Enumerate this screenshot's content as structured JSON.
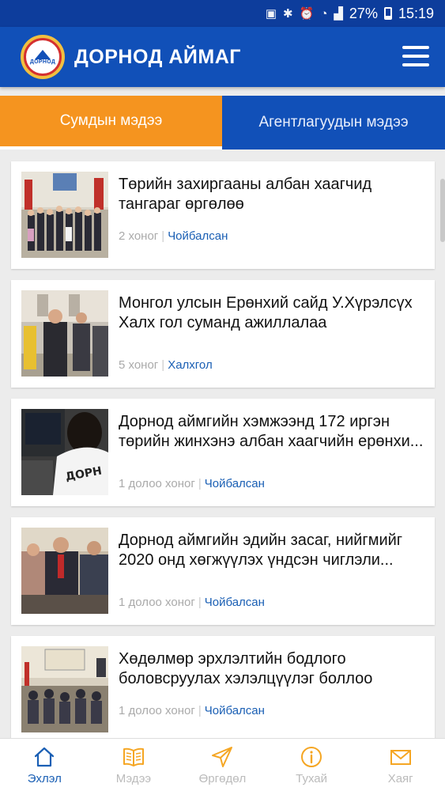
{
  "status_bar": {
    "battery": "27%",
    "time": "15:19"
  },
  "app": {
    "title": "ДОРНОД АЙМАГ",
    "logo_text": "ДОРНОД"
  },
  "tabs": [
    {
      "label": "Сумдын мэдээ",
      "active": true
    },
    {
      "label": "Агентлагуудын мэдээ",
      "active": false
    }
  ],
  "news": [
    {
      "title": "Төрийн захиргааны албан хаагчид тангараг өргөлөө",
      "time": "2 хоног",
      "location": "Чойбалсан"
    },
    {
      "title": "Монгол улсын Ерөнхий сайд У.Хүрэлсүх Халх гол суманд ажиллалаа",
      "time": "5 хоног",
      "location": "Халхгол"
    },
    {
      "title": "Дорнод аймгийн хэмжээнд 172 иргэн төрийн жинхэнэ албан хаагчийн ерөнхи...",
      "time": "1 долоо хоног",
      "location": "Чойбалсан"
    },
    {
      "title": "Дорнод аймгийн эдийн засаг, нийгмийг 2020 онд хөгжүүлэх үндсэн чиглэли...",
      "time": "1 долоо хоног",
      "location": "Чойбалсан"
    },
    {
      "title": "Хөдөлмөр эрхлэлтийн бодлого боловсруулах хэлэлцүүлэг боллоо",
      "time": "1 долоо хоног",
      "location": "Чойбалсан"
    }
  ],
  "bottom_nav": [
    {
      "label": "Эхлэл",
      "icon": "home-icon",
      "active": true
    },
    {
      "label": "Мэдээ",
      "icon": "news-icon",
      "active": false
    },
    {
      "label": "Өргөдөл",
      "icon": "send-icon",
      "active": false
    },
    {
      "label": "Тухай",
      "icon": "info-icon",
      "active": false
    },
    {
      "label": "Хаяг",
      "icon": "mail-icon",
      "active": false
    }
  ],
  "colors": {
    "primary": "#1150b8",
    "status_bar": "#0d3d9c",
    "accent": "#f5941f",
    "link": "#1a5fb4"
  }
}
